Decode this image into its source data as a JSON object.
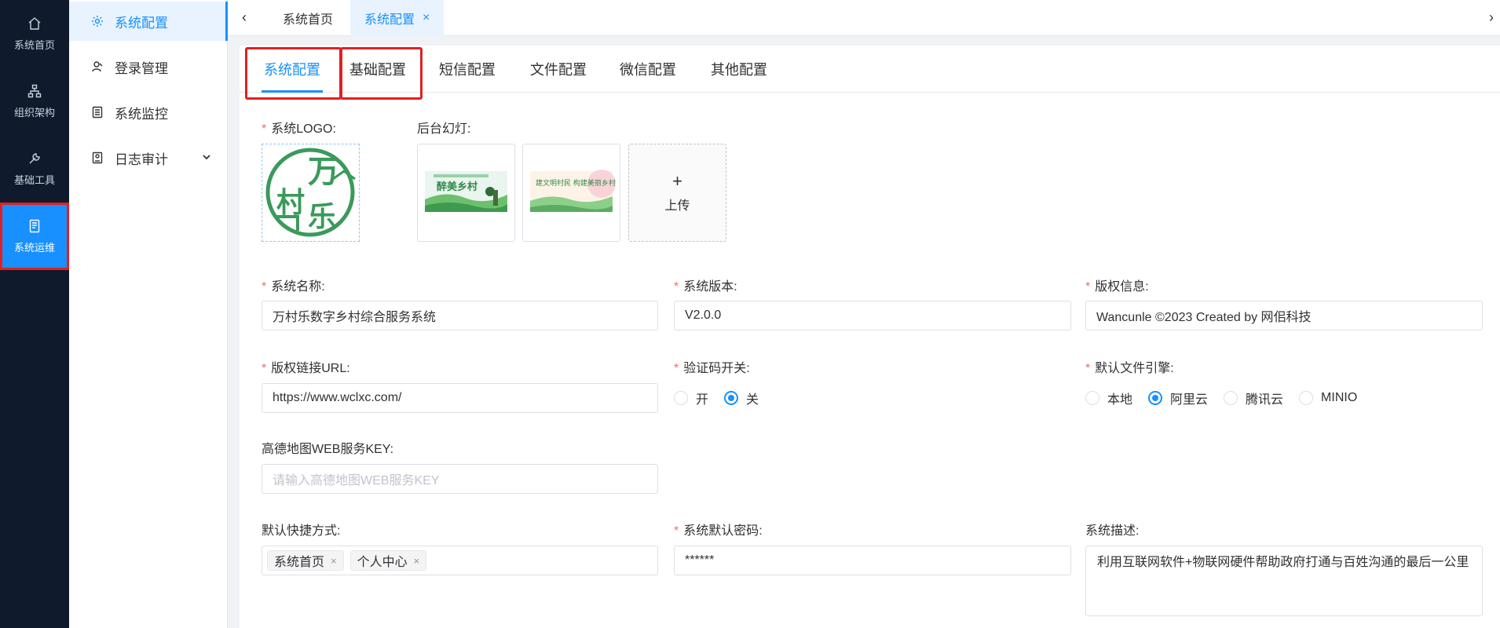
{
  "rail": {
    "items": [
      {
        "label": "系统首页",
        "icon": "home-icon"
      },
      {
        "label": "组织架构",
        "icon": "org-chart-icon"
      },
      {
        "label": "基础工具",
        "icon": "wrench-icon"
      },
      {
        "label": "系统运维",
        "icon": "document-icon",
        "active": true
      }
    ]
  },
  "submenu": {
    "items": [
      {
        "label": "系统配置",
        "icon": "gear-icon",
        "active": true
      },
      {
        "label": "登录管理",
        "icon": "login-icon"
      },
      {
        "label": "系统监控",
        "icon": "monitor-icon"
      },
      {
        "label": "日志审计",
        "icon": "log-icon",
        "expandable": true
      }
    ]
  },
  "topbar": {
    "tabs": [
      {
        "label": "系统首页"
      },
      {
        "label": "系统配置",
        "active": true,
        "closable": true
      }
    ]
  },
  "config_tabs": [
    "系统配置",
    "基础配置",
    "短信配置",
    "文件配置",
    "微信配置",
    "其他配置"
  ],
  "form": {
    "logo_label": "系统LOGO:",
    "logo_text": [
      "万",
      "村",
      "乐"
    ],
    "slides_label": "后台幻灯:",
    "slide1_text": "醉美乡村",
    "slide2_text": "建文明村民 构建美丽乡村",
    "upload_label": "上传",
    "system_name_label": "系统名称:",
    "system_name_value": "万村乐数字乡村综合服务系统",
    "system_version_label": "系统版本:",
    "system_version_value": "V2.0.0",
    "copyright_label": "版权信息:",
    "copyright_value": "Wancunle ©2023 Created by 网佀科技",
    "copyright_url_label": "版权链接URL:",
    "copyright_url_value": "https://www.wclxc.com/",
    "captcha_label": "验证码开关:",
    "captcha_options": [
      "开",
      "关"
    ],
    "captcha_selected": "关",
    "file_engine_label": "默认文件引擎:",
    "file_engine_options": [
      "本地",
      "阿里云",
      "腾讯云",
      "MINIO"
    ],
    "file_engine_selected": "阿里云",
    "amap_key_label": "高德地图WEB服务KEY:",
    "amap_key_placeholder": "请输入高德地图WEB服务KEY",
    "shortcut_label": "默认快捷方式:",
    "shortcut_tags": [
      "系统首页",
      "个人中心"
    ],
    "default_password_label": "系统默认密码:",
    "default_password_value": "******",
    "description_label": "系统描述:",
    "description_value": "利用互联网软件+物联网硬件帮助政府打通与百姓沟通的最后一公里"
  },
  "colors": {
    "accent": "#1890ff",
    "rail_bg": "#0f1b2d",
    "highlight_box": "#e02020",
    "required": "#f56c6c"
  }
}
